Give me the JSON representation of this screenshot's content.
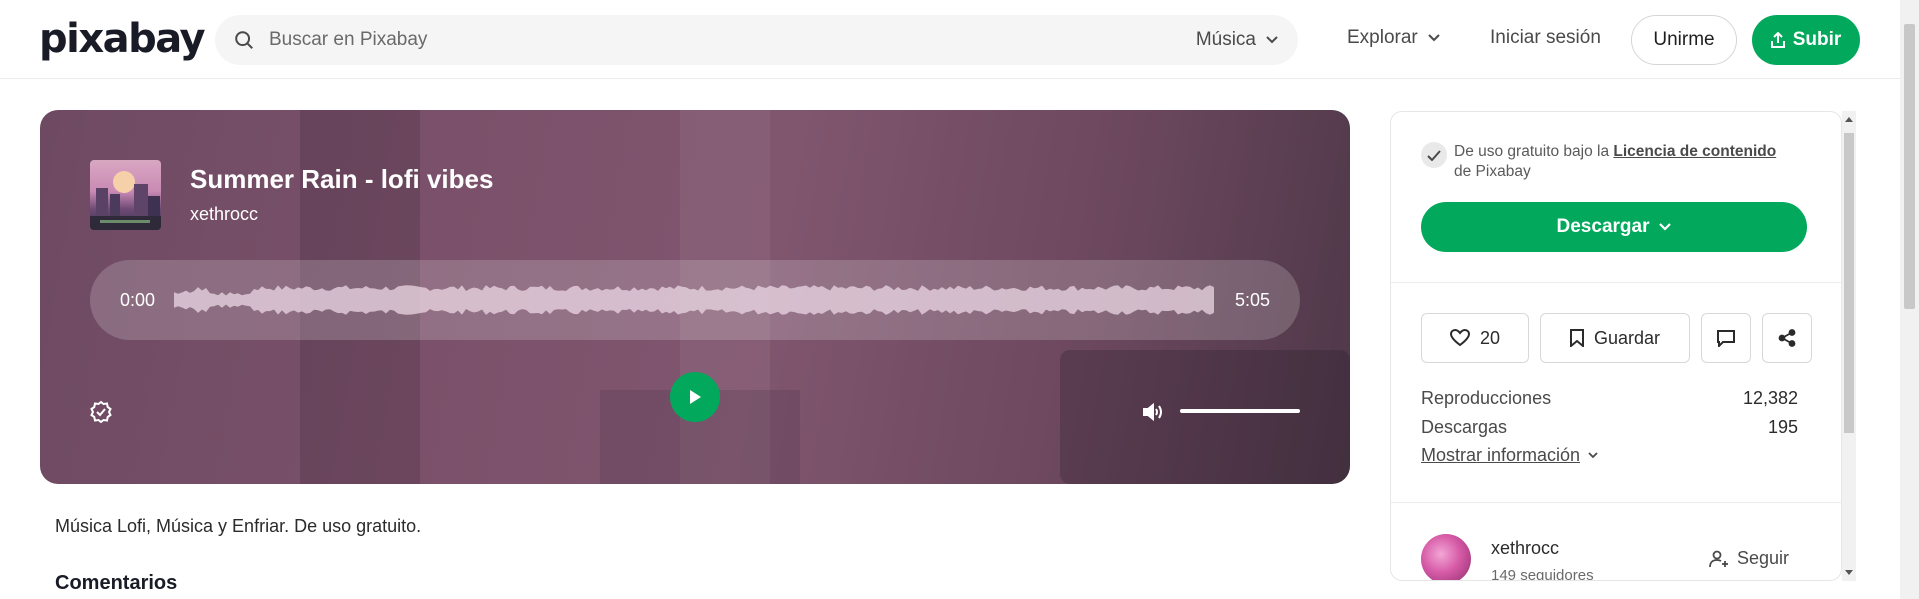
{
  "header": {
    "logo": "pixabay",
    "search_placeholder": "Buscar en Pixabay",
    "search_category": "Música",
    "explore_label": "Explorar",
    "login_label": "Iniciar sesión",
    "join_label": "Unirme",
    "upload_label": "Subir"
  },
  "player": {
    "title": "Summer Rain - lofi vibes",
    "artist": "xethrocc",
    "time_current": "0:00",
    "time_total": "5:05"
  },
  "description": "Música Lofi, Música y Enfriar. De uso gratuito.",
  "comments_heading": "Comentarios",
  "sidebar": {
    "license_prefix": "De uso gratuito bajo la ",
    "license_link": "Licencia de contenido",
    "license_suffix": "de Pixabay",
    "download_label": "Descargar",
    "likes": "20",
    "save_label": "Guardar",
    "stats": {
      "plays_label": "Reproducciones",
      "plays_value": "12,382",
      "downloads_label": "Descargas",
      "downloads_value": "195"
    },
    "more_info_label": "Mostrar información",
    "author_name": "xethrocc",
    "author_followers": "149 seguidores",
    "follow_label": "Seguir"
  },
  "colors": {
    "accent": "#02a95c",
    "player_bg": "#7a506a"
  },
  "icons": [
    "search-icon",
    "chevron-down-icon",
    "upload-icon",
    "play-icon",
    "verified-badge-icon",
    "volume-icon",
    "check-icon",
    "heart-icon",
    "bookmark-icon",
    "comment-icon",
    "share-icon",
    "add-user-icon"
  ]
}
